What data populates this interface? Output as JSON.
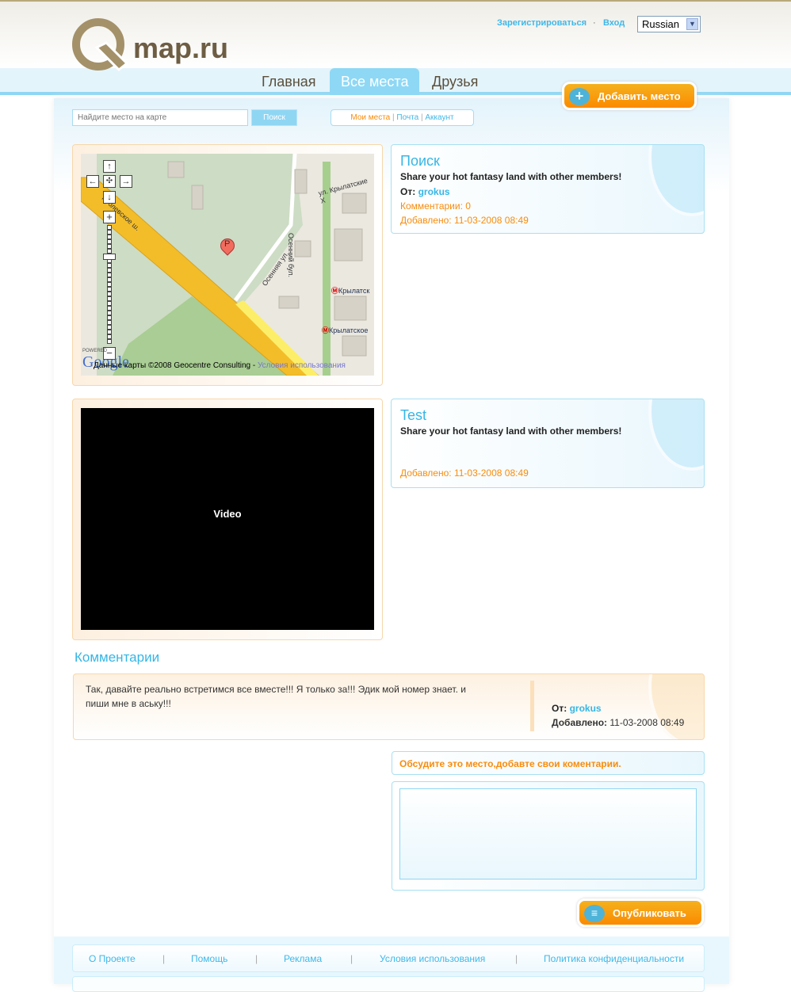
{
  "header": {
    "logo_text": "map.ru",
    "register": "Зарегистрироваться",
    "dot": "·",
    "login": "Вход",
    "language": "Russian"
  },
  "nav": {
    "tabs": [
      "Главная",
      "Все места",
      "Друзья"
    ],
    "active": "Все места",
    "add_place": "Добавить место"
  },
  "search": {
    "placeholder": "Найдите место на карте",
    "button": "Поиск"
  },
  "sublinks": {
    "my_places": "Мои места",
    "mail": "Почта",
    "account": "Аккаунт",
    "sep": "|"
  },
  "map": {
    "streets": [
      "ул. Крылатские Х",
      "Осенний бул.",
      "Осенняя ул.",
      "Рублевское ш."
    ],
    "metro": [
      "Крылатск",
      "Крылатское"
    ],
    "marker": "P",
    "attribution": "Данные карты ©2008 Geocentre Consulting -",
    "terms": "Условия использования",
    "powered": "POWERED",
    "google": "Google"
  },
  "places": [
    {
      "title": "Поиск",
      "desc": "Share your hot fantasy land with other members!",
      "from_label": "От:",
      "author": "grokus",
      "comments": "Комментарии: 0",
      "added": "Добавлено: 11-03-2008 08:49"
    },
    {
      "title": "Test",
      "desc": "Share your hot fantasy land with other members!",
      "added": "Добавлено: 11-03-2008 08:49"
    }
  ],
  "video": {
    "label": "Video"
  },
  "comments": {
    "heading": "Комментарии",
    "items": [
      {
        "text": "Так, давайте реально встретимся все вместе!!! Я только за!!! Эдик мой номер знает. и пиши мне в аську!!!",
        "from_label": "От:",
        "author": "grokus",
        "added_label": "Добавлено:",
        "added": "11-03-2008 08:49"
      }
    ],
    "prompt": "Обсудите это место,добавте свои коментарии.",
    "textarea": "",
    "publish": "Опубликовать"
  },
  "footer": {
    "links": [
      "О Проекте",
      "Помощь",
      "Реклама",
      "Условия использования",
      "Политика конфиденциальности"
    ]
  },
  "colors": {
    "accent": "#35b6e6",
    "orange": "#f98c0c",
    "brand": "#6d5d43"
  }
}
